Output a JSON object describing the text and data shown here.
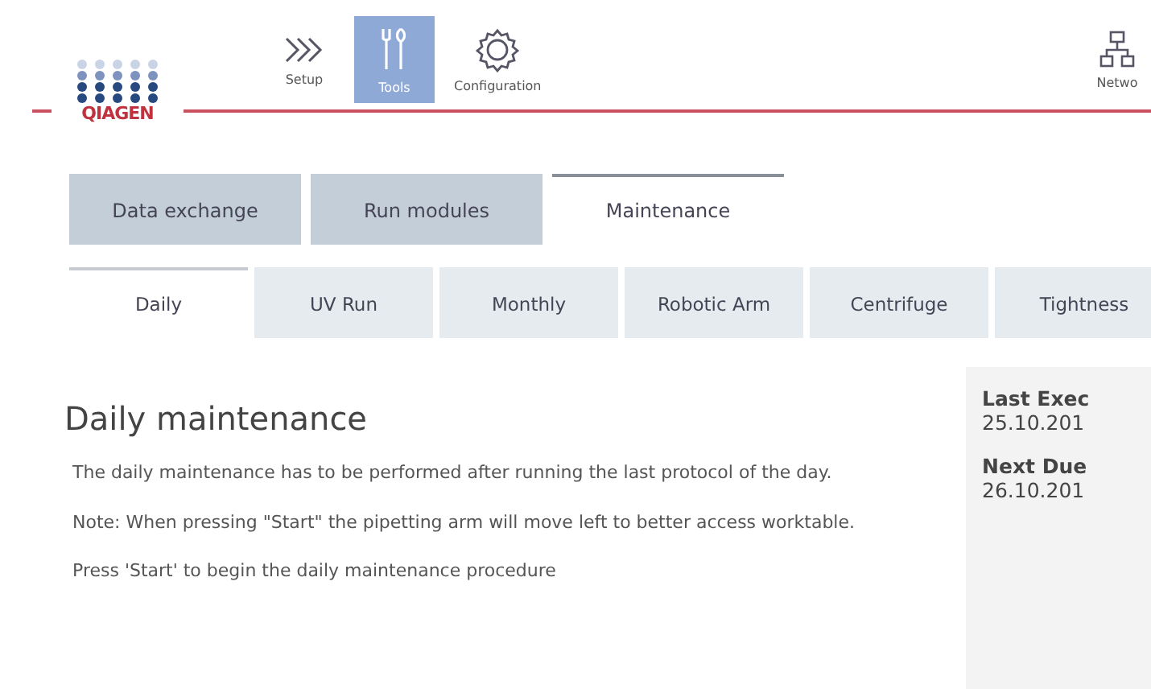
{
  "header": {
    "logo": "QIAGEN",
    "nav": [
      {
        "label": "Setup",
        "kind": "setup",
        "selected": false
      },
      {
        "label": "Tools",
        "kind": "tools",
        "selected": true
      },
      {
        "label": "Configuration",
        "kind": "config",
        "selected": false
      }
    ],
    "network": {
      "label": "Netwo"
    }
  },
  "tabs": [
    {
      "label": "Data exchange",
      "selected": false
    },
    {
      "label": "Run modules",
      "selected": false
    },
    {
      "label": "Maintenance",
      "selected": true
    }
  ],
  "subtabs": [
    {
      "label": "Daily",
      "selected": true
    },
    {
      "label": "UV Run",
      "selected": false
    },
    {
      "label": "Monthly",
      "selected": false
    },
    {
      "label": "Robotic Arm",
      "selected": false
    },
    {
      "label": "Centrifuge",
      "selected": false
    },
    {
      "label": "Tightness",
      "selected": false
    }
  ],
  "content": {
    "title": "Daily maintenance",
    "paragraphs": [
      "The daily maintenance has to be performed after running the last protocol of the day.",
      "Note: When pressing \"Start\" the pipetting arm will move left to better access worktable.",
      "Press 'Start' to begin the daily maintenance procedure"
    ]
  },
  "info": [
    {
      "label": "Last Exec",
      "value": "25.10.201"
    },
    {
      "label": "Next Due",
      "value": "26.10.201"
    }
  ]
}
